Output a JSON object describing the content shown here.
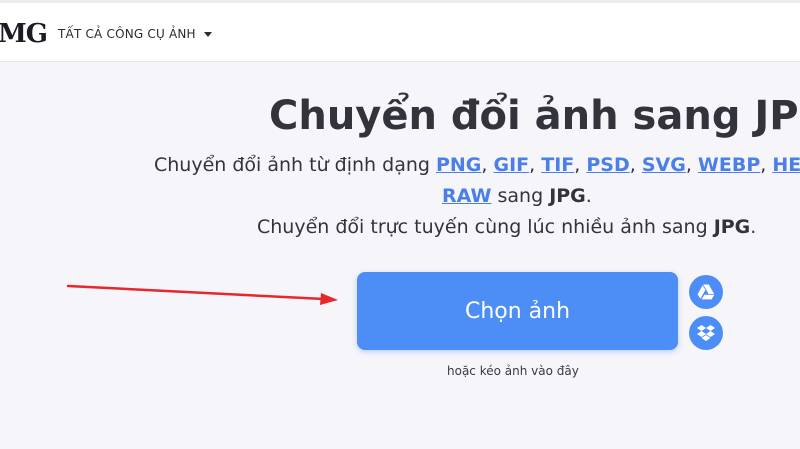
{
  "header": {
    "logo_text": "MG",
    "tools_menu_label": "TẤT CẢ CÔNG CỤ ẢNH"
  },
  "main": {
    "title": "Chuyển đổi ảnh sang JPG",
    "line1_prefix": "Chuyển đổi ảnh từ định dạng ",
    "formats": [
      "PNG",
      "GIF",
      "TIF",
      "PSD",
      "SVG",
      "WEBP",
      "HE",
      "RAW"
    ],
    "line2_middle": " sang ",
    "target_format": "JPG",
    "line2_suffix": ".",
    "line3_prefix": "Chuyển đổi trực tuyến cùng lúc nhiều ảnh sang ",
    "line3_suffix": "."
  },
  "upload": {
    "choose_button_label": "Chọn ảnh",
    "drop_hint": "hoặc kéo ảnh vào đây",
    "google_drive_icon": "google-drive-icon",
    "dropbox_icon": "dropbox-icon"
  },
  "colors": {
    "accent": "#4d8ef6",
    "link": "#4a7ee8",
    "annotation_arrow": "#e8262b",
    "text": "#33333b",
    "background": "#f5f5fa"
  }
}
